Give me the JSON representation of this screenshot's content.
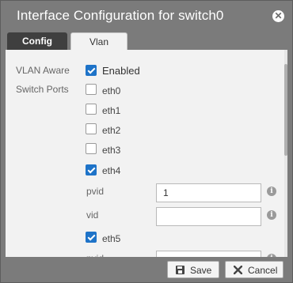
{
  "dialog": {
    "title": "Interface Configuration for switch0"
  },
  "tabs": [
    {
      "label": "Config",
      "active": true
    },
    {
      "label": "Vlan",
      "active": false
    }
  ],
  "form": {
    "vlan_aware_label": "VLAN Aware",
    "vlan_aware_value": "Enabled",
    "vlan_aware_checked": true,
    "switch_ports_label": "Switch Ports",
    "ports": [
      {
        "name": "eth0",
        "checked": false
      },
      {
        "name": "eth1",
        "checked": false
      },
      {
        "name": "eth2",
        "checked": false
      },
      {
        "name": "eth3",
        "checked": false
      },
      {
        "name": "eth4",
        "checked": true
      },
      {
        "name": "eth5",
        "checked": true
      }
    ],
    "eth4_pvid_label": "pvid",
    "eth4_pvid_value": "1",
    "eth4_vid_label": "vid",
    "eth4_vid_value": "",
    "eth5_pvid_label": "pvid"
  },
  "footer": {
    "save_label": "Save",
    "cancel_label": "Cancel"
  },
  "colors": {
    "dialog_bg": "#7b7b7b",
    "active_tab": "#3f3f3f",
    "checkbox_on": "#1e73c8"
  },
  "icons": {
    "close": "close-icon",
    "info": "info-icon",
    "save": "floppy-disk-icon",
    "cancel": "x-mark-icon"
  }
}
